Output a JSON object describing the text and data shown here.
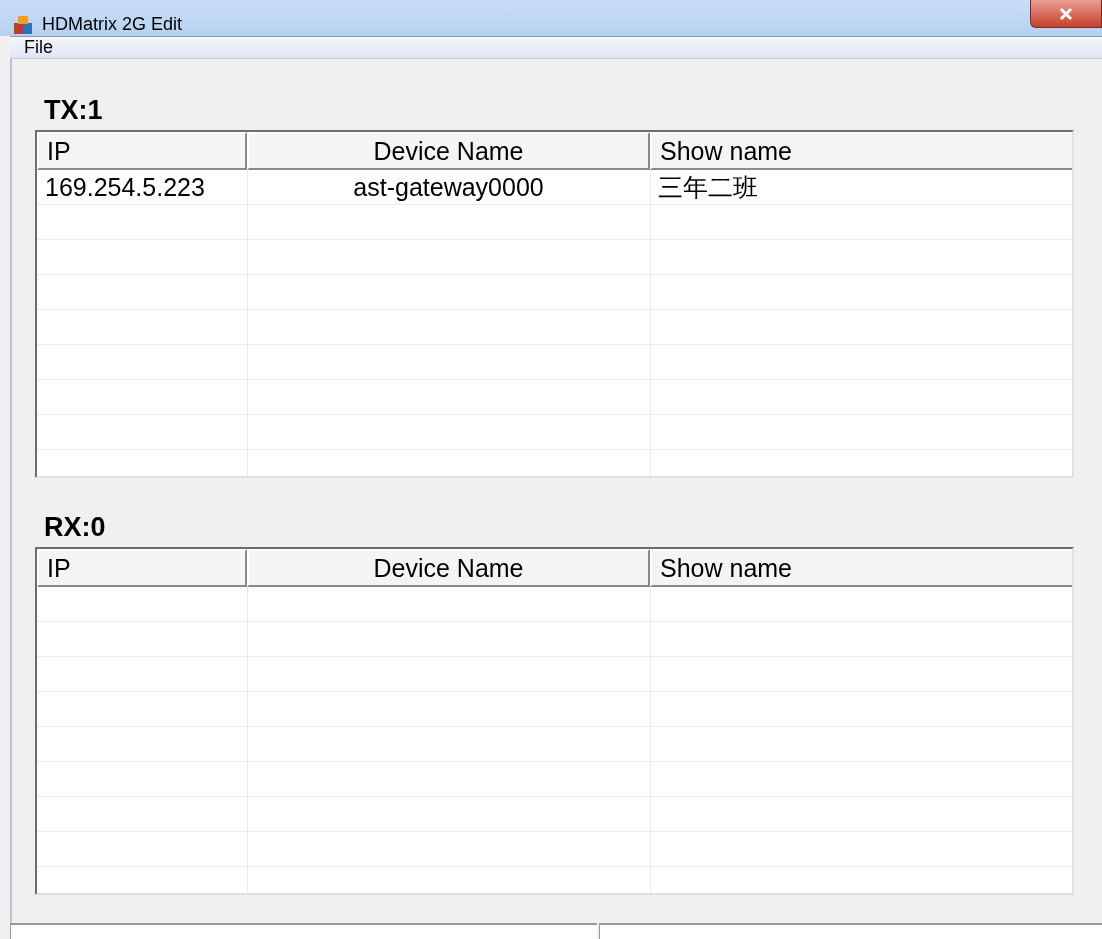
{
  "window": {
    "title": "HDMatrix 2G Edit"
  },
  "menu": [
    "File"
  ],
  "sections": [
    {
      "heading": "TX:1",
      "columns": [
        "IP",
        "Device Name",
        "Show name"
      ],
      "rows": [
        [
          "169.254.5.223",
          "ast-gateway0000",
          "三年二班"
        ]
      ]
    },
    {
      "heading": "RX:0",
      "columns": [
        "IP",
        "Device Name",
        "Show name"
      ]
    }
  ]
}
